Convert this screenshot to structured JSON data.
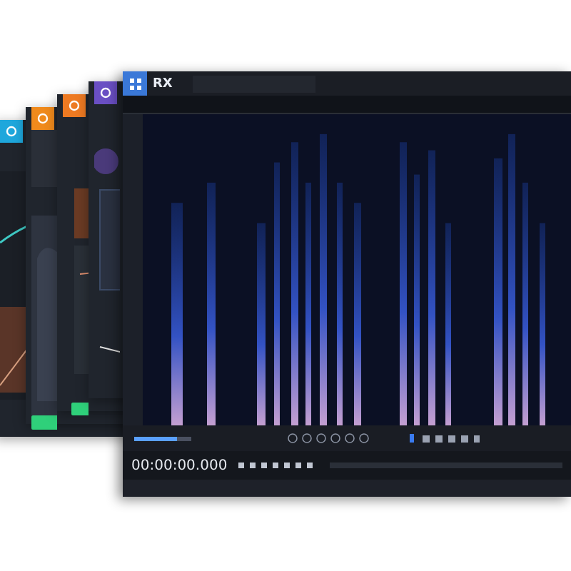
{
  "plugin_windows": [
    {
      "kind": "eq",
      "color": "#1ea7dc"
    },
    {
      "kind": "meter",
      "color": "#f08a1c"
    },
    {
      "kind": "dynamics",
      "color": "#ee7a22"
    },
    {
      "kind": "vocal",
      "color": "#6a4fc4"
    }
  ],
  "rx": {
    "logo": "RX",
    "zoom_slider": {
      "level": 0.75
    },
    "timecode": "00:00:00.000"
  }
}
